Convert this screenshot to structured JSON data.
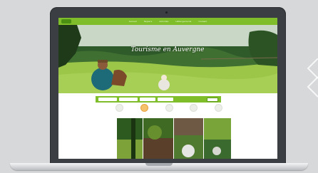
{
  "site": {
    "hero_title": "Tourisme en Auvergne",
    "nav_items": [
      "Accueil",
      "Séjours",
      "Activités",
      "Hébergements",
      "Contact"
    ]
  },
  "colors": {
    "brand_green": "#7fbd2a",
    "laptop_frame": "#3b3e42",
    "background": "#d6d8da"
  }
}
